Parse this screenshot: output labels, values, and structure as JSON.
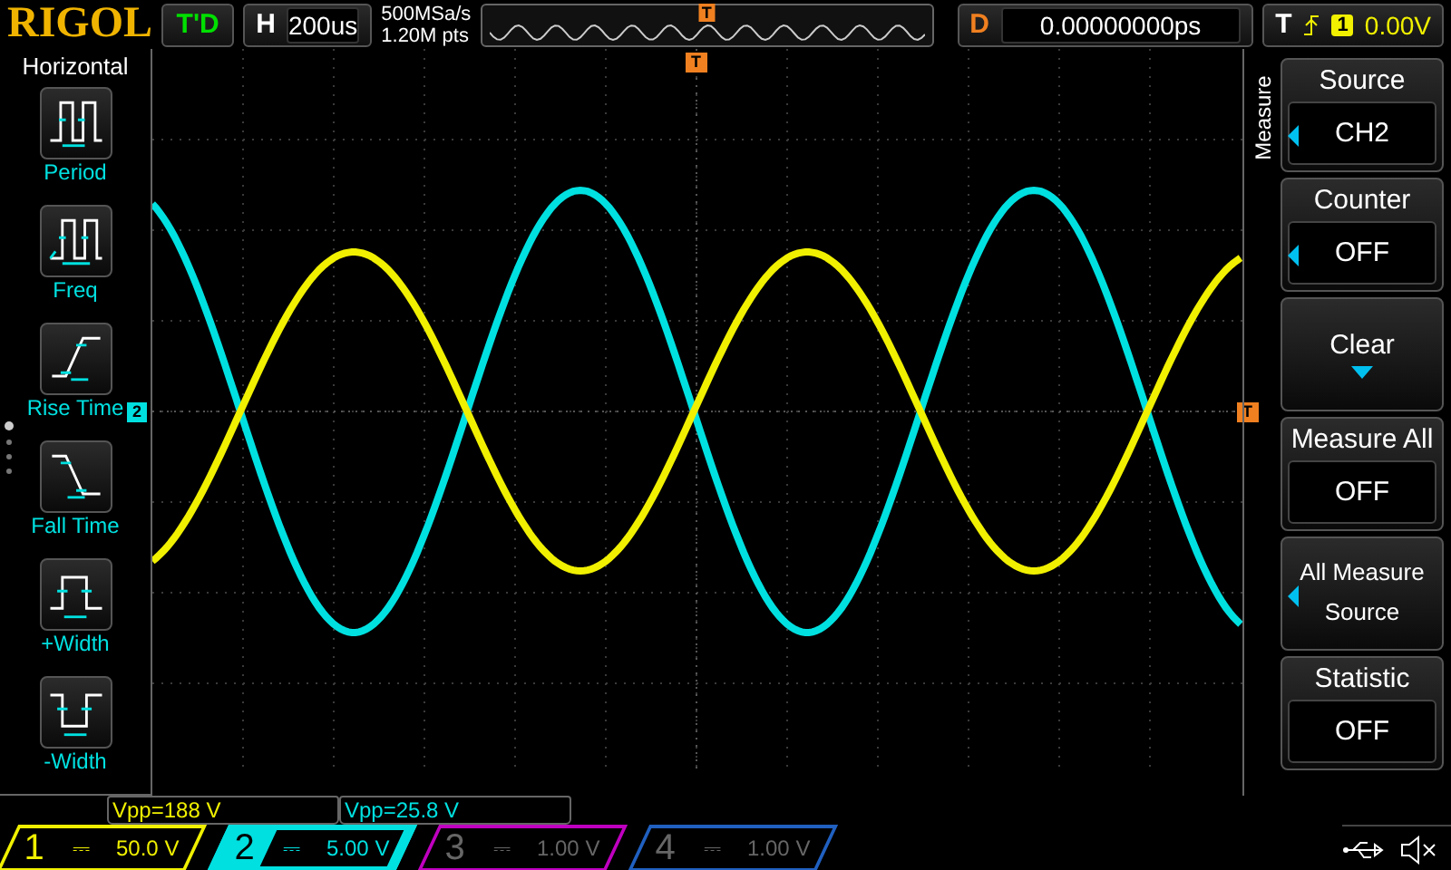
{
  "top_bar": {
    "logo": "RIGOL",
    "trigger_status": "T'D",
    "timebase": {
      "label": "H",
      "value": "200us"
    },
    "sample_rate": "500MSa/s",
    "memory_depth": "1.20M pts",
    "trigger_position_marker": "T",
    "delay": {
      "label": "D",
      "value": "0.00000000ps"
    },
    "trigger": {
      "label": "T",
      "source": "1",
      "level": "0.00V"
    }
  },
  "left_menu": {
    "title": "Horizontal",
    "items": [
      {
        "kind": "period",
        "label": "Period"
      },
      {
        "kind": "freq",
        "label": "Freq"
      },
      {
        "kind": "rise",
        "label": "Rise Time"
      },
      {
        "kind": "fall",
        "label": "Fall Time"
      },
      {
        "kind": "pwidth",
        "label": "+Width"
      },
      {
        "kind": "nwidth",
        "label": "-Width"
      }
    ]
  },
  "screen": {
    "channel_marker": "2",
    "trigger_top_marker": "T",
    "trigger_level_marker": "T"
  },
  "right_menu": {
    "title": "Measure",
    "items": [
      {
        "kind": "option",
        "label": "Source",
        "value": "CH2",
        "arrow": true
      },
      {
        "kind": "option",
        "label": "Counter",
        "value": "OFF",
        "arrow": true
      },
      {
        "kind": "action",
        "label": "Clear"
      },
      {
        "kind": "option",
        "label": "Measure All",
        "value": "OFF",
        "arrow": false
      },
      {
        "kind": "choice",
        "label": "All Measure\nSource",
        "arrow": true
      },
      {
        "kind": "option",
        "label": "Statistic",
        "value": "OFF",
        "arrow": false
      }
    ]
  },
  "measurements": [
    {
      "text": "Vpp=188 V"
    },
    {
      "text": "Vpp=25.8 V"
    }
  ],
  "channels": [
    {
      "number": "1",
      "coupling": "⎓",
      "scale": "50.0 V",
      "on": true,
      "selected": false,
      "color": "#f0f000"
    },
    {
      "number": "2",
      "coupling": "⎓",
      "scale": "5.00 V",
      "on": true,
      "selected": true,
      "color": "#00e0e0"
    },
    {
      "number": "3",
      "coupling": "⎓",
      "scale": "1.00 V",
      "on": false,
      "selected": false,
      "color": "#c000c0"
    },
    {
      "number": "4",
      "coupling": "⎓",
      "scale": "1.00 V",
      "on": false,
      "selected": false,
      "color": "#2060c0"
    }
  ]
}
